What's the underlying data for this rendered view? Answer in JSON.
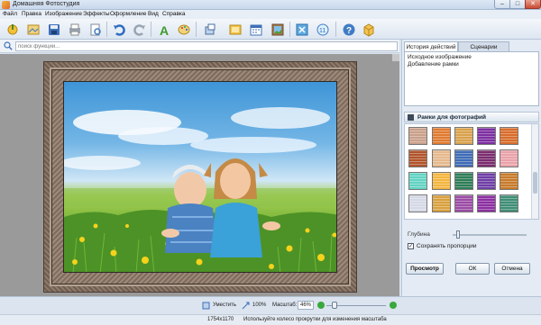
{
  "window": {
    "title": "Домашняя Фотостудия",
    "minimize": "–",
    "maximize": "□",
    "close": "✕"
  },
  "menu": [
    "Файл",
    "Правка",
    "Изображение",
    "Эффекты",
    "Оформление",
    "Вид",
    "Справка"
  ],
  "toolbar": {
    "icons": [
      "open-icon",
      "crop-icon",
      "save-icon",
      "print-icon",
      "preview-icon",
      "undo-icon",
      "redo-icon",
      "text-icon",
      "palette-icon",
      "rotate-icon",
      "image-icon",
      "calendar-icon",
      "frame-icon",
      "resize-icon",
      "filesize-icon",
      "help-icon",
      "box-icon"
    ]
  },
  "search": {
    "placeholder": "поиск функций..."
  },
  "right_panel": {
    "tabs": [
      "История действий",
      "Сценарии"
    ],
    "history": [
      "Исходное изображение",
      "Добавление рамки"
    ],
    "frames_header": "Рамки для фотографий",
    "depth_label": "Глубина",
    "keep_proportions": "Сохранять пропорции",
    "keep_proportions_checked": true,
    "buttons": {
      "preview": "Просмотр",
      "ok": "ОК",
      "cancel": "Отмена"
    }
  },
  "colors": {
    "accent": "#3f7cc5",
    "thumb_colors": [
      "#c9a08a",
      "#e07a2f",
      "#d9a14c",
      "#7d2ea1",
      "#d86c2a",
      "#b0542b",
      "#e5b88c",
      "#3f6cb5",
      "#7a2c6e",
      "#e9a2a9",
      "#63d3c3",
      "#f4b53f",
      "#2f7d57",
      "#6e3ea6",
      "#c77a2a",
      "#d5d8e6",
      "#d8a03e",
      "#9b4ca5",
      "#8c2fa1",
      "#3e8e76",
      "#a0322c",
      "#d0b17a",
      "#e2e6ec",
      "#3b9c63"
    ]
  },
  "status": {
    "fit": "Уместить",
    "zoom_100": "100%",
    "scale_label": "Масштаб:",
    "scale_value": "46%",
    "dimensions": "1754x1170",
    "hint": "Используйте колесо прокрутки для изменения масштаба"
  }
}
